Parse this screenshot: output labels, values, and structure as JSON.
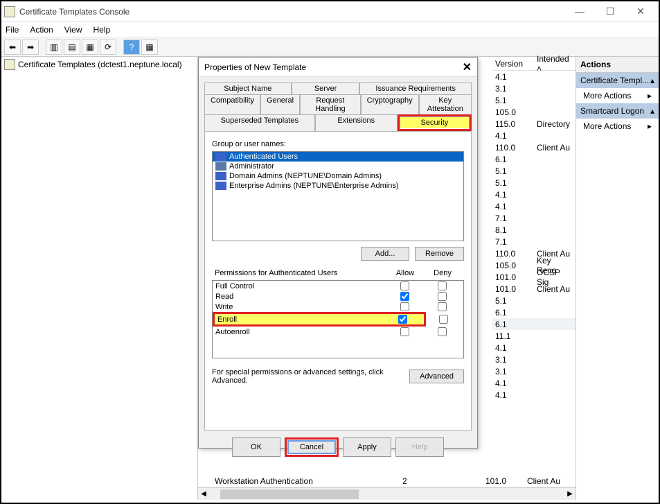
{
  "window": {
    "title": "Certificate Templates Console",
    "menus": [
      "File",
      "Action",
      "View",
      "Help"
    ]
  },
  "tree": {
    "root": "Certificate Templates (dctest1.neptune.local)"
  },
  "columns": {
    "version": "Version",
    "intended": "Intended"
  },
  "rows": [
    {
      "v": "4.1",
      "p": ""
    },
    {
      "v": "3.1",
      "p": ""
    },
    {
      "v": "5.1",
      "p": ""
    },
    {
      "v": "105.0",
      "p": ""
    },
    {
      "v": "115.0",
      "p": "Directory"
    },
    {
      "v": "4.1",
      "p": ""
    },
    {
      "v": "110.0",
      "p": "Client Au"
    },
    {
      "v": "6.1",
      "p": ""
    },
    {
      "v": "5.1",
      "p": ""
    },
    {
      "v": "5.1",
      "p": ""
    },
    {
      "v": "4.1",
      "p": ""
    },
    {
      "v": "4.1",
      "p": ""
    },
    {
      "v": "7.1",
      "p": ""
    },
    {
      "v": "8.1",
      "p": ""
    },
    {
      "v": "7.1",
      "p": ""
    },
    {
      "v": "110.0",
      "p": "Client Au"
    },
    {
      "v": "105.0",
      "p": "Key Reco"
    },
    {
      "v": "101.0",
      "p": "OCSP Sig"
    },
    {
      "v": "101.0",
      "p": "Client Au"
    },
    {
      "v": "5.1",
      "p": ""
    },
    {
      "v": "6.1",
      "p": ""
    },
    {
      "v": "6.1",
      "p": ""
    },
    {
      "v": "11.1",
      "p": ""
    },
    {
      "v": "4.1",
      "p": ""
    },
    {
      "v": "3.1",
      "p": ""
    },
    {
      "v": "3.1",
      "p": ""
    },
    {
      "v": "4.1",
      "p": ""
    },
    {
      "v": "4.1",
      "p": ""
    }
  ],
  "bottomRow": {
    "name": "Workstation Authentication",
    "num": "2",
    "ver": "101.0",
    "purp": "Client Au"
  },
  "actions": {
    "header": "Actions",
    "group1": "Certificate Templ...",
    "more": "More Actions",
    "group2": "Smartcard Logon"
  },
  "dialog": {
    "title": "Properties of New Template",
    "tabsTop": [
      "Subject Name",
      "Server",
      "Issuance Requirements"
    ],
    "tabsMid": [
      "Compatibility",
      "General",
      "Request Handling",
      "Cryptography",
      "Key Attestation"
    ],
    "tabsBot": [
      "Superseded Templates",
      "Extensions",
      "Security"
    ],
    "groupLabel": "Group or user names:",
    "users": [
      "Authenticated Users",
      "Administrator",
      "Domain Admins (NEPTUNE\\Domain Admins)",
      "Enterprise Admins (NEPTUNE\\Enterprise Admins)"
    ],
    "addBtn": "Add...",
    "removeBtn": "Remove",
    "permLabel": "Permissions for Authenticated Users",
    "allow": "Allow",
    "deny": "Deny",
    "perms": [
      {
        "name": "Full Control",
        "allow": false,
        "deny": false
      },
      {
        "name": "Read",
        "allow": true,
        "deny": false
      },
      {
        "name": "Write",
        "allow": false,
        "deny": false
      },
      {
        "name": "Enroll",
        "allow": true,
        "deny": false,
        "highlight": true
      },
      {
        "name": "Autoenroll",
        "allow": false,
        "deny": false
      }
    ],
    "advText": "For special permissions or advanced settings, click Advanced.",
    "advBtn": "Advanced",
    "ok": "OK",
    "cancel": "Cancel",
    "apply": "Apply",
    "help": "Help"
  }
}
